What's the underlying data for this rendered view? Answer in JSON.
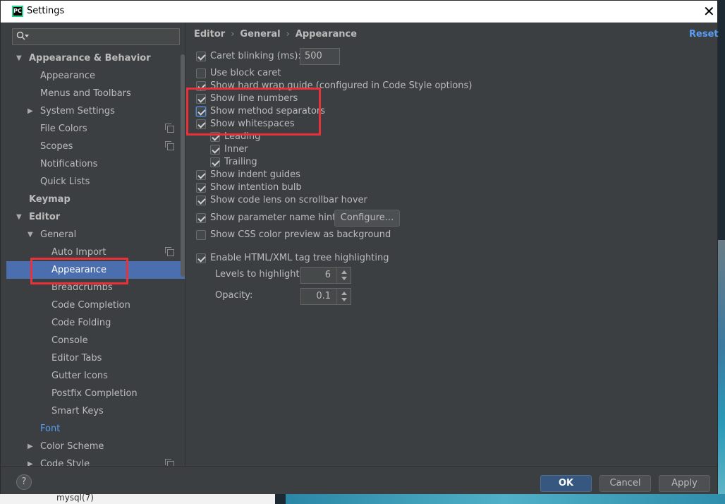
{
  "window": {
    "title": "Settings",
    "app_icon_text": "PC"
  },
  "search": {
    "placeholder": ""
  },
  "sidebar": {
    "items": [
      {
        "label": "Appearance & Behavior",
        "expanded": true,
        "bold": true
      },
      {
        "label": "Appearance"
      },
      {
        "label": "Menus and Toolbars"
      },
      {
        "label": "System Settings",
        "expanded": false
      },
      {
        "label": "File Colors",
        "has_copy_icon": true
      },
      {
        "label": "Scopes",
        "has_copy_icon": true
      },
      {
        "label": "Notifications"
      },
      {
        "label": "Quick Lists"
      },
      {
        "label": "Keymap",
        "bold": true
      },
      {
        "label": "Editor",
        "expanded": true,
        "bold": true
      },
      {
        "label": "General",
        "expanded": true
      },
      {
        "label": "Auto Import",
        "has_copy_icon": true
      },
      {
        "label": "Appearance",
        "selected": true
      },
      {
        "label": "Breadcrumbs"
      },
      {
        "label": "Code Completion"
      },
      {
        "label": "Code Folding"
      },
      {
        "label": "Console"
      },
      {
        "label": "Editor Tabs"
      },
      {
        "label": "Gutter Icons"
      },
      {
        "label": "Postfix Completion"
      },
      {
        "label": "Smart Keys"
      },
      {
        "label": "Font",
        "link": true
      },
      {
        "label": "Color Scheme",
        "expanded": false
      },
      {
        "label": "Code Style",
        "expanded": false,
        "has_copy_icon": true
      }
    ]
  },
  "content": {
    "breadcrumb": [
      "Editor",
      "General",
      "Appearance"
    ],
    "reset_label": "Reset",
    "options": [
      {
        "label": "Caret blinking (ms):",
        "checked": true
      },
      {
        "label": "Use block caret",
        "checked": false
      },
      {
        "label": "Show hard wrap guide (configured in Code Style options)",
        "checked": true
      },
      {
        "label": "Show line numbers",
        "checked": true
      },
      {
        "label": "Show method separators",
        "checked": true
      },
      {
        "label": "Show whitespaces",
        "checked": true
      },
      {
        "label": "Leading",
        "checked": true
      },
      {
        "label": "Inner",
        "checked": true
      },
      {
        "label": "Trailing",
        "checked": true
      },
      {
        "label": "Show indent guides",
        "checked": true
      },
      {
        "label": "Show intention bulb",
        "checked": true
      },
      {
        "label": "Show code lens on scrollbar hover",
        "checked": true
      },
      {
        "label": "Show parameter name hints",
        "checked": true
      },
      {
        "label": "Show CSS color preview as background",
        "checked": false
      },
      {
        "label": "Enable HTML/XML tag tree highlighting",
        "checked": true
      }
    ],
    "caret_blinking_value": "500",
    "configure_label": "Configure...",
    "levels_label": "Levels to highlight:",
    "levels_value": "6",
    "opacity_label": "Opacity:",
    "opacity_value": "0.1"
  },
  "footer": {
    "help_label": "?",
    "ok_label": "OK",
    "cancel_label": "Cancel",
    "apply_label": "Apply"
  },
  "background": {
    "text": "mysql(7)"
  },
  "colors": {
    "dialog_bg": "#3c3f41",
    "selection": "#4b6eaf",
    "link": "#589df6",
    "annotation_red": "#e8313a",
    "ok_button": "#365880"
  }
}
